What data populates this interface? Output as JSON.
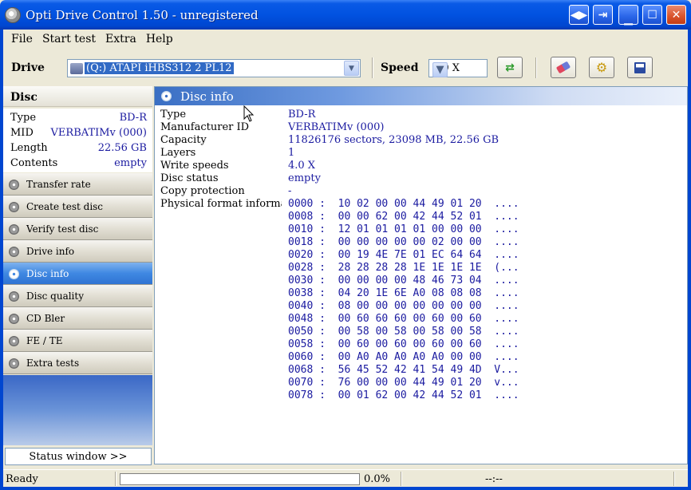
{
  "window": {
    "title": "Opti Drive Control 1.50 - unregistered",
    "controls": [
      "restore-swap",
      "switch-window",
      "minimize",
      "maximize",
      "close"
    ]
  },
  "menu": [
    "File",
    "Start test",
    "Extra",
    "Help"
  ],
  "toolbar": {
    "drive_label": "Drive",
    "drive_value": "(Q:)   ATAPI iHBS312   2 PL12",
    "speed_label": "Speed",
    "speed_value": "4.0 X",
    "buttons": [
      "refresh-icon",
      "eraser-icon",
      "settings-icon",
      "save-icon"
    ]
  },
  "disc": {
    "header": "Disc",
    "props": [
      {
        "key": "Type",
        "value": "BD-R"
      },
      {
        "key": "MID",
        "value": "VERBATIMv (000)"
      },
      {
        "key": "Length",
        "value": "22.56 GB"
      },
      {
        "key": "Contents",
        "value": "empty"
      }
    ]
  },
  "nav": [
    {
      "label": "Transfer rate",
      "active": false
    },
    {
      "label": "Create test disc",
      "active": false
    },
    {
      "label": "Verify test disc",
      "active": false
    },
    {
      "label": "Drive info",
      "active": false
    },
    {
      "label": "Disc info",
      "active": true
    },
    {
      "label": "Disc quality",
      "active": false
    },
    {
      "label": "CD Bler",
      "active": false
    },
    {
      "label": "FE / TE",
      "active": false
    },
    {
      "label": "Extra tests",
      "active": false
    }
  ],
  "status_window_button": "Status window >>",
  "main": {
    "title": "Disc info",
    "rows": [
      {
        "key": "Type",
        "value": "BD-R"
      },
      {
        "key": "Manufacturer ID",
        "value": "VERBATIMv (000)"
      },
      {
        "key": "Capacity",
        "value": "11826176 sectors, 23098 MB, 22.56 GB"
      },
      {
        "key": "Layers",
        "value": "1"
      },
      {
        "key": "Write speeds",
        "value": "4.0 X"
      },
      {
        "key": "Disc status",
        "value": "empty"
      },
      {
        "key": "Copy protection",
        "value": "-"
      },
      {
        "key": "Physical format informa...",
        "value": ""
      }
    ],
    "hex_dump": [
      "0000 :  10 02 00 00 44 49 01 20  ....",
      "0008 :  00 00 62 00 42 44 52 01  ....",
      "0010 :  12 01 01 01 01 00 00 00  ....",
      "0018 :  00 00 00 00 00 02 00 00  ....",
      "0020 :  00 19 4E 7E 01 EC 64 64  ....",
      "0028 :  28 28 28 28 1E 1E 1E 1E  (...",
      "0030 :  00 00 00 00 48 46 73 04  ....",
      "0038 :  04 20 1E 6E A0 08 08 08  ....",
      "0040 :  08 00 00 00 00 00 00 00  ....",
      "0048 :  00 60 60 60 00 60 00 60  ....",
      "0050 :  00 58 00 58 00 58 00 58  ....",
      "0058 :  00 60 00 60 00 60 00 60  ....",
      "0060 :  00 A0 A0 A0 A0 A0 00 00  ....",
      "0068 :  56 45 52 42 41 54 49 4D  V...",
      "0070 :  76 00 00 00 44 49 01 20  v...",
      "0078 :  00 01 62 00 42 44 52 01  ...."
    ]
  },
  "statusbar": {
    "ready": "Ready",
    "progress_fraction": 0.0,
    "percent": "0.0%",
    "time": "--:--"
  },
  "colors": {
    "title_bar": "#0152e0",
    "value_text": "#1a1aa0",
    "active_nav": "#3f88e2",
    "window_bg": "#ece9d8"
  }
}
